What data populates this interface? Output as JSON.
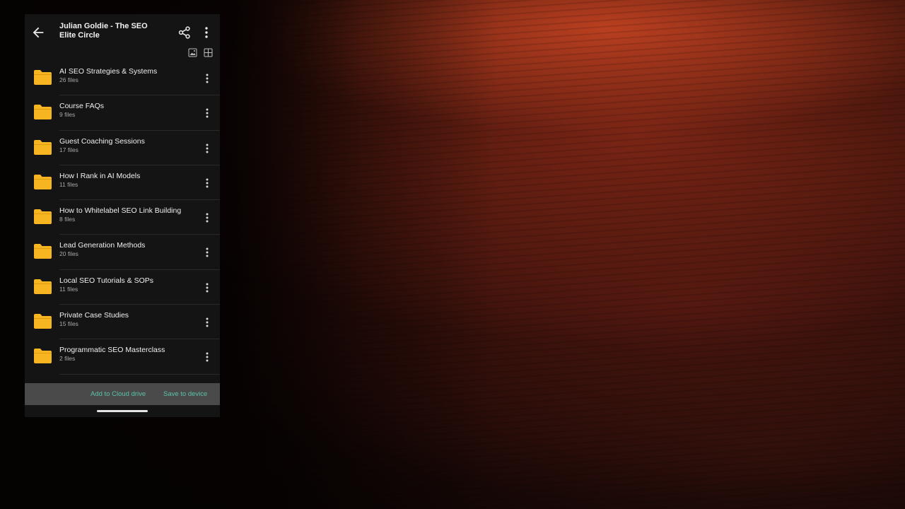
{
  "header": {
    "title": "Julian Goldie - The SEO Elite Circle",
    "icons": [
      "back-arrow-icon",
      "share-icon",
      "more-vertical-icon",
      "image-view-icon",
      "grid-view-icon"
    ]
  },
  "folders": [
    {
      "name": "AI SEO Strategies & Systems",
      "count": "26 files"
    },
    {
      "name": "Course FAQs",
      "count": "9 files"
    },
    {
      "name": "Guest Coaching Sessions",
      "count": "17 files"
    },
    {
      "name": "How I Rank in AI Models",
      "count": "11 files"
    },
    {
      "name": "How to Whitelabel SEO Link Building",
      "count": "8 files"
    },
    {
      "name": "Lead Generation Methods",
      "count": "20 files"
    },
    {
      "name": "Local SEO Tutorials & SOPs",
      "count": "11 files"
    },
    {
      "name": "Private Case Studies",
      "count": "15 files"
    },
    {
      "name": "Programmatic SEO Masterclass",
      "count": "2 files"
    }
  ],
  "footer": {
    "add_to_cloud": "Add to Cloud drive",
    "save_to_device": "Save to device"
  },
  "colors": {
    "folder": "#f7b521",
    "accent": "#5cc2a9",
    "panel_bg": "#141414",
    "bottom_bar": "#4a4a4a"
  }
}
